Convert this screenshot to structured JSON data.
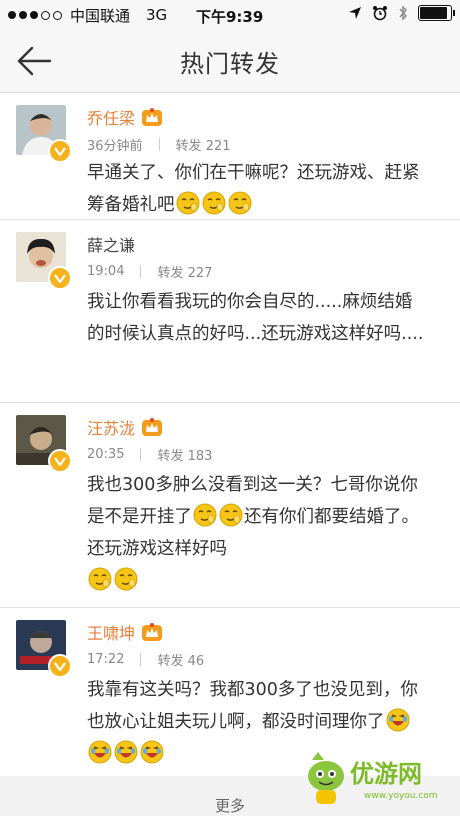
{
  "status_bar": {
    "carrier": "中国联通",
    "network": "3G",
    "time": "下午9:39"
  },
  "nav": {
    "title": "热门转发"
  },
  "comments": [
    {
      "name": "乔任梁",
      "vip": true,
      "time": "36分钟前",
      "reposts": "转发 221",
      "text": "早通关了、你们在干嘛呢？还玩游戏、赶紧筹备婚礼吧",
      "emoji": [
        "smirk",
        "smirk",
        "smirk"
      ]
    },
    {
      "name": "薛之谦",
      "vip": false,
      "time": "19:04",
      "reposts": "转发 227",
      "text": "我让你看看我玩的你会自尽的.....麻烦结婚的时候认真点的好吗...还玩游戏这样好吗...."
    },
    {
      "name": "汪苏泷",
      "vip": true,
      "time": "20:35",
      "reposts": "转发 183",
      "text_a": "我也300多肿么没看到这一关？七哥你说你是不是开挂了",
      "text_b": "还有你们都要结婚了。还玩游戏这样好吗",
      "emoji_a": [
        "smirk",
        "smirk"
      ],
      "emoji_b": [
        "smirk",
        "smirk"
      ]
    },
    {
      "name": "王啸坤",
      "vip": true,
      "time": "17:22",
      "reposts": "转发 46",
      "text": "我靠有这关吗？我都300多了也没见到，你也放心让姐夫玩儿啊，都没时间理你了",
      "emoji": [
        "laugh",
        "laugh",
        "laugh",
        "laugh"
      ]
    }
  ],
  "footer": {
    "more": "更多",
    "watermark_text": "优游网",
    "watermark_url": "www.yoyou.com"
  },
  "colors": {
    "vip_name": "#e8803a",
    "badge": "#f6b21b",
    "emoji": "#f5c518"
  }
}
